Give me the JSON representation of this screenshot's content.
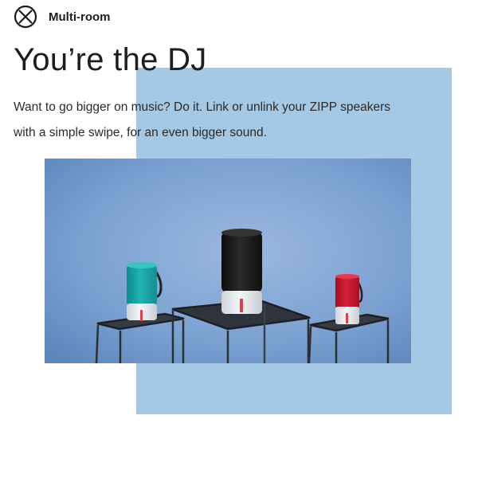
{
  "section": {
    "label": "Multi-room",
    "icon": "x-circle-icon"
  },
  "hero": {
    "headline": "You’re the DJ",
    "body": "Want to go bigger on music? Do it. Link or unlink your ZIPP speakers with a simple swipe, for an even bigger sound."
  },
  "colors": {
    "accent_block": "#a5c8e4",
    "photo_backdrop": "#7ba1d1",
    "speaker_teal": "#1aa5a5",
    "speaker_black": "#1a1a1a",
    "speaker_red": "#d0122e"
  },
  "photo": {
    "subject": "three-speakers-on-tables"
  }
}
